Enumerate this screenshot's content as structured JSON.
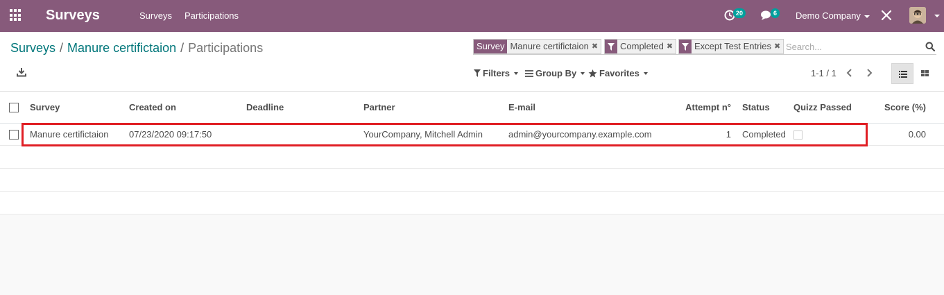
{
  "navbar": {
    "app_title": "Surveys",
    "menu": [
      "Surveys",
      "Participations"
    ],
    "activity_count": "20",
    "message_count": "6",
    "company": "Demo Company",
    "bg_color": "#875a7b"
  },
  "breadcrumb": {
    "items": [
      "Surveys",
      "Manure certifictaion"
    ],
    "current": "Participations"
  },
  "search": {
    "facets": [
      {
        "label": "Survey",
        "value": "Manure certifictaion",
        "icon": "filter-icon"
      },
      {
        "label": "filter-icon",
        "value": "Completed"
      },
      {
        "label": "filter-icon",
        "value": "Except Test Entries"
      }
    ],
    "placeholder": "Search..."
  },
  "toolbar": {
    "filters_label": "Filters",
    "groupby_label": "Group By",
    "favorites_label": "Favorites",
    "pager": "1-1 / 1"
  },
  "table": {
    "columns": [
      "Survey",
      "Created on",
      "Deadline",
      "Partner",
      "E-mail",
      "Attempt n°",
      "Status",
      "Quizz Passed",
      "Score (%)"
    ],
    "rows": [
      {
        "survey": "Manure certifictaion",
        "created_on": "07/23/2020 09:17:50",
        "deadline": "",
        "partner": "YourCompany, Mitchell Admin",
        "email": "admin@yourcompany.example.com",
        "attempt": "1",
        "status": "Completed",
        "quizz_passed": false,
        "score": "0.00"
      }
    ]
  },
  "colors": {
    "accent": "#875a7b",
    "link": "#00767a",
    "highlight": "#e01e24"
  }
}
